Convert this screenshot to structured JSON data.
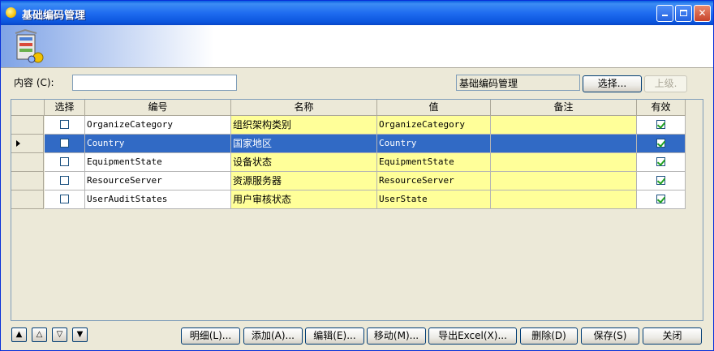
{
  "window": {
    "title": "基础编码管理",
    "colors": {
      "titlebar": "#0A5FE0",
      "selection": "#316AC5",
      "editable_cell": "#FFFF99"
    }
  },
  "filter": {
    "content_label": "内容 (C):",
    "content_value": "",
    "parent_value": "基础编码管理",
    "select_button": "选择...",
    "up_button": "上级."
  },
  "table": {
    "columns": [
      "选择",
      "编号",
      "名称",
      "值",
      "备注",
      "有效"
    ],
    "rows": [
      {
        "selected": false,
        "code": "OrganizeCategory",
        "name": "组织架构类别",
        "value": "OrganizeCategory",
        "remark": "",
        "valid": true
      },
      {
        "selected": false,
        "code": "Country",
        "name": "国家地区",
        "value": "Country",
        "remark": "",
        "valid": true
      },
      {
        "selected": false,
        "code": "EquipmentState",
        "name": "设备状态",
        "value": "EquipmentState",
        "remark": "",
        "valid": true
      },
      {
        "selected": false,
        "code": "ResourceServer",
        "name": "资源服务器",
        "value": "ResourceServer",
        "remark": "",
        "valid": true
      },
      {
        "selected": false,
        "code": "UserAuditStates",
        "name": "用户审核状态",
        "value": "UserState",
        "remark": "",
        "valid": true
      }
    ],
    "current_row": 1
  },
  "toolbar": {
    "detail": "明细(L)...",
    "add": "添加(A)...",
    "edit": "编辑(E)...",
    "move": "移动(M)...",
    "export": "导出Excel(X)...",
    "delete": "删除(D)",
    "save": "保存(S)",
    "close": "关闭"
  },
  "nav": {
    "icons": [
      "move-top-icon",
      "move-up-icon",
      "move-down-icon",
      "move-bottom-icon"
    ]
  }
}
